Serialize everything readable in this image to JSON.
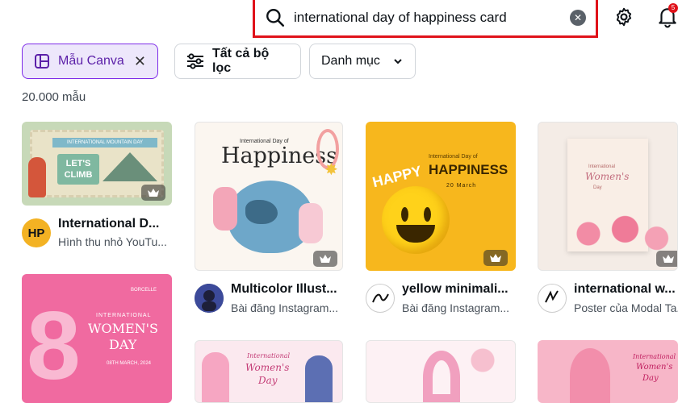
{
  "search": {
    "value": "international day of happiness card"
  },
  "notifications": {
    "badge": "5"
  },
  "filters": {
    "canva_chip": "Mẫu Canva",
    "all_filters": "Tất cả bộ lọc",
    "category": "Danh mục"
  },
  "results_count": "20.000 mẫu",
  "cards": [
    {
      "title": "International D...",
      "subtitle": "Hình thu nhỏ YouTu...",
      "avatar_text": "HP",
      "thumb_lines": [
        "LET'S",
        "CLIMB"
      ],
      "thumb_banner": "INTERNATIONAL MOUNTAIN DAY"
    },
    {
      "title": "Multicolor Illust...",
      "subtitle": "Bài đăng Instagram...",
      "thumb_small": "International Day of",
      "thumb_big": "Happiness"
    },
    {
      "title": "yellow minimali...",
      "subtitle": "Bài đăng Instagram...",
      "thumb_small": "International Day of",
      "thumb_big": "HAPPINESS",
      "thumb_date": "20 March",
      "thumb_happy": "HAPPY"
    },
    {
      "title": "international w...",
      "subtitle": "Poster của Modal Ta...",
      "thumb_lines": [
        "International",
        "Women's",
        "Day"
      ]
    },
    {
      "thumb_brand": "BORCELLE",
      "thumb_small": "INTERNATIONAL",
      "thumb_big1": "WOMEN'S",
      "thumb_big2": "DAY",
      "thumb_date": "08TH MARCH, 2024"
    },
    {
      "thumb_lines": [
        "International",
        "Women's",
        "Day"
      ]
    },
    {},
    {
      "thumb_lines": [
        "International",
        "Women's",
        "Day"
      ]
    }
  ],
  "colors": {
    "accent": "#7d2ae8",
    "highlight": "#e0121a",
    "yellow_card": "#f7b71d",
    "pink_card": "#f06aa0"
  }
}
